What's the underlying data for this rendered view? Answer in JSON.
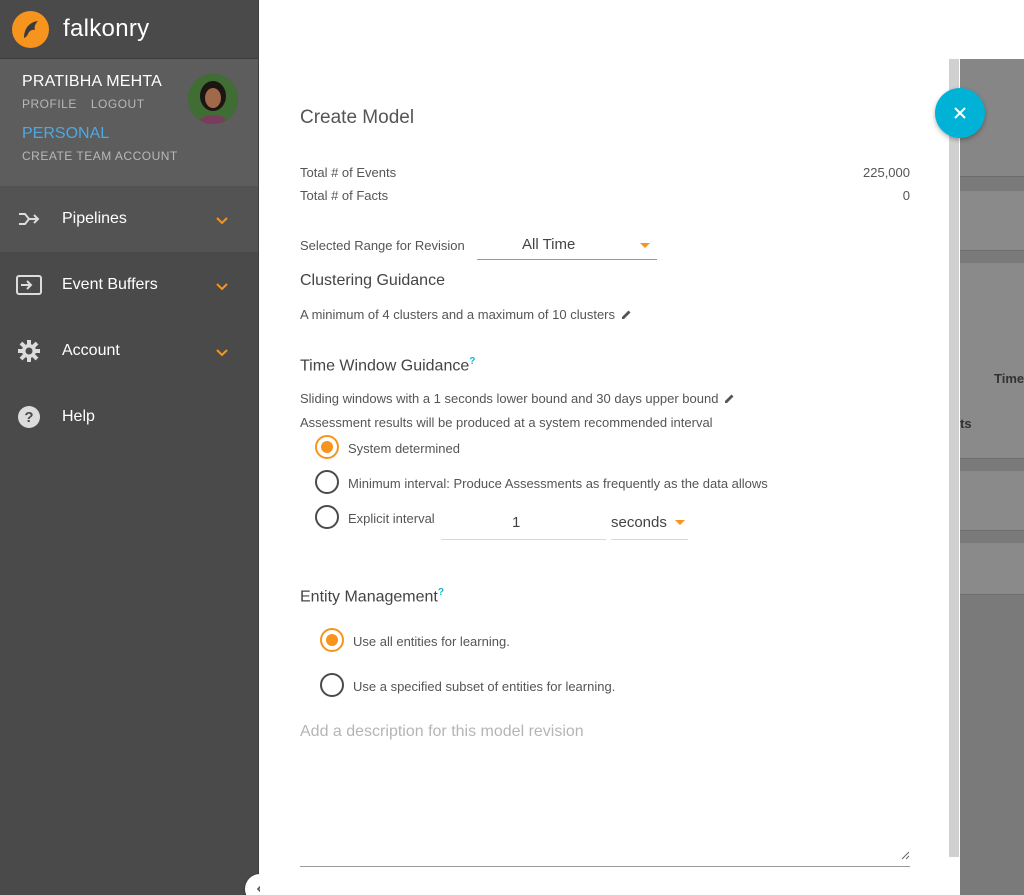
{
  "brand": {
    "name": "falkonry"
  },
  "user": {
    "name": "PRATIBHA MEHTA",
    "profile_link": "PROFILE",
    "logout_link": "LOGOUT",
    "account_type": "PERSONAL",
    "create_team": "CREATE TEAM ACCOUNT"
  },
  "nav": {
    "items": [
      {
        "label": "Pipelines",
        "icon": "pipeline-icon"
      },
      {
        "label": "Event Buffers",
        "icon": "input-icon"
      },
      {
        "label": "Account",
        "icon": "gear-icon"
      },
      {
        "label": "Help",
        "icon": "help-icon"
      }
    ]
  },
  "background": {
    "col_label": "Time",
    "row_label": "ts"
  },
  "modal": {
    "title": "Create Model",
    "stats": [
      {
        "label": "Total # of Events",
        "value": "225,000"
      },
      {
        "label": "Total # of Facts",
        "value": "0"
      }
    ],
    "range_label": "Selected Range for Revision",
    "range_value": "All Time",
    "clustering": {
      "heading": "Clustering Guidance",
      "text": "A minimum of 4 clusters and a maximum of 10 clusters"
    },
    "time_window": {
      "heading": "Time Window Guidance",
      "help_mark": "?",
      "text": "Sliding windows with a 1 seconds lower bound and 30 days upper bound",
      "assessment_text": "Assessment results will be produced at a system recommended interval",
      "options": [
        {
          "label": "System determined",
          "selected": true
        },
        {
          "label": "Minimum interval: Produce Assessments as frequently as the data allows",
          "selected": false
        },
        {
          "label": "Explicit interval",
          "selected": false
        }
      ],
      "interval_value": "1",
      "interval_unit": "seconds"
    },
    "entity": {
      "heading": "Entity Management",
      "help_mark": "?",
      "options": [
        {
          "label": "Use all entities for learning.",
          "selected": true
        },
        {
          "label": "Use a specified subset of entities for learning.",
          "selected": false
        }
      ]
    },
    "description_placeholder": "Add a description for this model revision"
  },
  "colors": {
    "accent": "#f7941d",
    "fab": "#00b2d6",
    "link": "#4fa8e0",
    "sidebar": "#4a4a4a"
  }
}
